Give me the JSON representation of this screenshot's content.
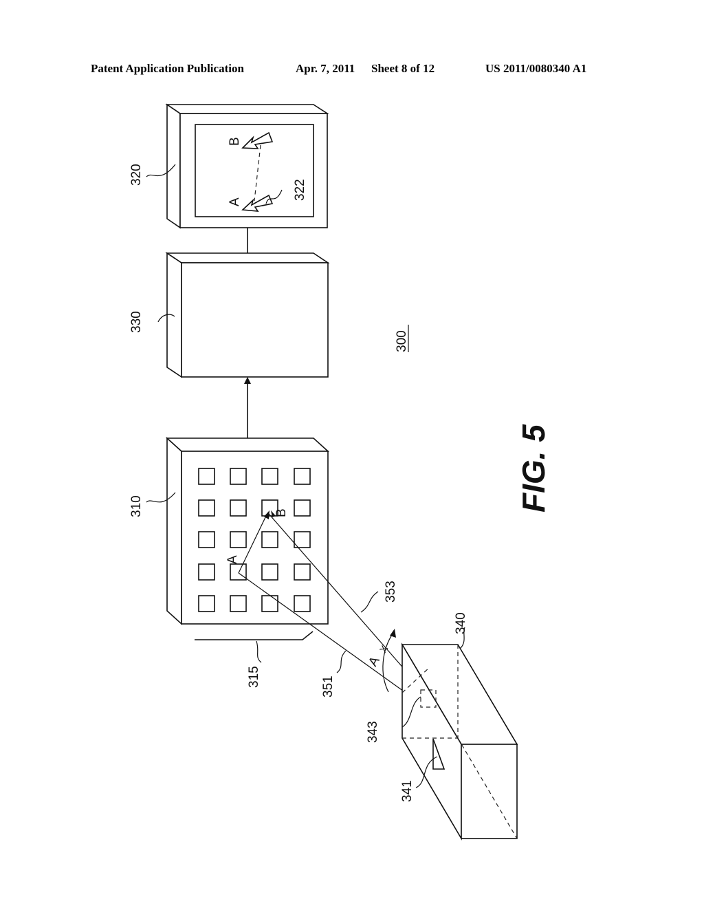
{
  "header": {
    "publication": "Patent Application Publication",
    "date": "Apr. 7, 2011",
    "sheet": "Sheet 8 of 12",
    "number": "US 2011/0080340 A1"
  },
  "figure": {
    "title": "FIG. 5",
    "system_ref": "300",
    "components": {
      "display": {
        "ref": "320",
        "cursor_ref": "322",
        "point_a": "A",
        "point_b": "B"
      },
      "processor": {
        "ref": "330"
      },
      "sensor_array": {
        "ref": "310",
        "point_a": "A",
        "point_b": "B"
      },
      "array_width": {
        "ref": "315"
      },
      "pointer": {
        "ref": "340",
        "emitter_ref": "341",
        "detector_ref": "343"
      },
      "beams": {
        "beam_a_ref": "351",
        "beam_b_ref": "353",
        "angle_label": "A",
        "angle_subscript": "X"
      }
    }
  }
}
